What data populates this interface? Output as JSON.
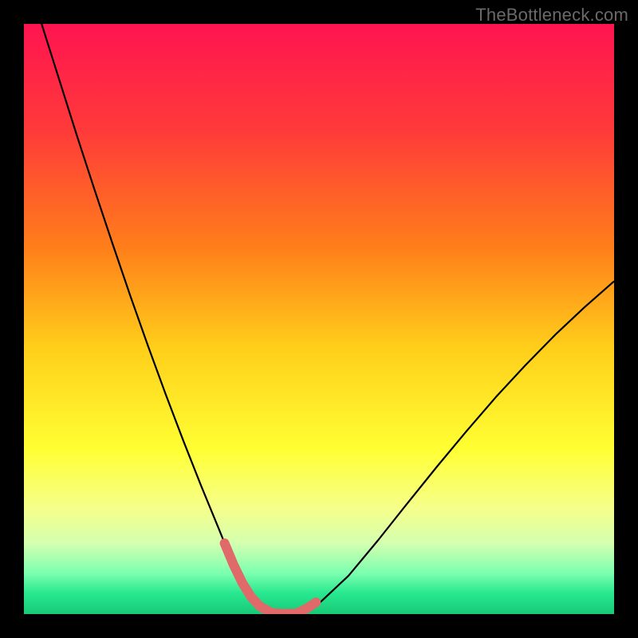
{
  "watermark": "TheBottleneck.com",
  "chart_data": {
    "type": "line",
    "title": "",
    "xlabel": "",
    "ylabel": "",
    "xlim": [
      0,
      100
    ],
    "ylim": [
      0,
      100
    ],
    "grid": false,
    "legend": false,
    "background_gradient": {
      "stops": [
        {
          "offset": 0.0,
          "color": "#ff1450"
        },
        {
          "offset": 0.18,
          "color": "#ff3a3a"
        },
        {
          "offset": 0.38,
          "color": "#ff7f1a"
        },
        {
          "offset": 0.55,
          "color": "#ffcf1a"
        },
        {
          "offset": 0.72,
          "color": "#ffff33"
        },
        {
          "offset": 0.82,
          "color": "#f6ff8a"
        },
        {
          "offset": 0.88,
          "color": "#d4ffb0"
        },
        {
          "offset": 0.93,
          "color": "#7dffb0"
        },
        {
          "offset": 0.965,
          "color": "#27e88f"
        },
        {
          "offset": 1.0,
          "color": "#18c978"
        }
      ]
    },
    "series": [
      {
        "name": "bottleneck-curve",
        "color": "#000000",
        "width": 2.2,
        "x": [
          3,
          6,
          9,
          12,
          15,
          18,
          21,
          24,
          27,
          30,
          33,
          34.5,
          36,
          37.5,
          39,
          40.5,
          42,
          46,
          50,
          55,
          60,
          65,
          70,
          75,
          80,
          85,
          90,
          95,
          100
        ],
        "y": [
          100,
          90.5,
          81,
          71.8,
          62.8,
          54,
          45.5,
          37.3,
          29.4,
          21.8,
          14.5,
          10.8,
          7.5,
          4.6,
          2.3,
          0.8,
          0.1,
          0.1,
          1.8,
          6.5,
          12.5,
          18.8,
          25.0,
          31.0,
          36.8,
          42.2,
          47.3,
          52.0,
          56.4
        ]
      },
      {
        "name": "highlight-segment",
        "color": "#e06a6a",
        "width": 12,
        "linecap": "round",
        "x": [
          34.0,
          35.5,
          37.0,
          38.5,
          40.0,
          42.0,
          44.0,
          46.0,
          46.6,
          48.0,
          49.5
        ],
        "y": [
          12.0,
          8.4,
          5.3,
          2.9,
          1.3,
          0.2,
          0.05,
          0.12,
          0.3,
          1.0,
          2.0
        ]
      }
    ]
  }
}
